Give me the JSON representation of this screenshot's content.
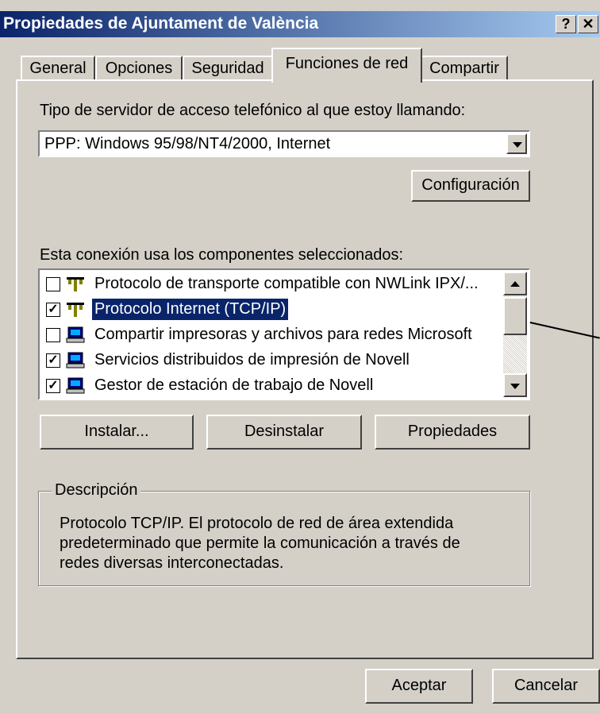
{
  "window": {
    "title": "Propiedades de Ajuntament de València",
    "help_button": "?",
    "close_button": "✕"
  },
  "tabs": [
    {
      "label": "General",
      "active": false
    },
    {
      "label": "Opciones",
      "active": false
    },
    {
      "label": "Seguridad",
      "active": false
    },
    {
      "label": "Funciones de red",
      "active": true
    },
    {
      "label": "Compartir",
      "active": false
    }
  ],
  "server_type": {
    "label": "Tipo de servidor de acceso telefónico al que estoy llamando:",
    "selected": "PPP: Windows 95/98/NT4/2000, Internet"
  },
  "config_button": "Configuración",
  "components": {
    "label": "Esta conexión usa los componentes seleccionados:",
    "items": [
      {
        "label": "Protocolo de transporte compatible con NWLink IPX/...",
        "checked": false,
        "icon": "network-protocol-icon",
        "selected": false
      },
      {
        "label": "Protocolo Internet (TCP/IP)",
        "checked": true,
        "icon": "network-protocol-icon",
        "selected": true
      },
      {
        "label": "Compartir impresoras y archivos para redes Microsoft",
        "checked": false,
        "icon": "network-service-icon",
        "selected": false
      },
      {
        "label": "Servicios distribuidos de impresión de Novell",
        "checked": true,
        "icon": "network-service-icon",
        "selected": false
      },
      {
        "label": "Gestor de estación de trabajo de Novell",
        "checked": true,
        "icon": "network-client-icon",
        "selected": false
      }
    ]
  },
  "actions": {
    "install": "Instalar...",
    "uninstall": "Desinstalar",
    "properties": "Propiedades"
  },
  "description": {
    "legend": "Descripción",
    "lines": [
      "Protocolo TCP/IP. El protocolo de red de área extendida",
      "predeterminado que permite la comunicación a través de",
      "redes diversas interconectadas."
    ]
  },
  "footer": {
    "accept": "Aceptar",
    "cancel": "Cancelar"
  },
  "colors": {
    "titlebar": "#0a246a",
    "selection": "#0a246a",
    "face": "#d4d0c8"
  }
}
